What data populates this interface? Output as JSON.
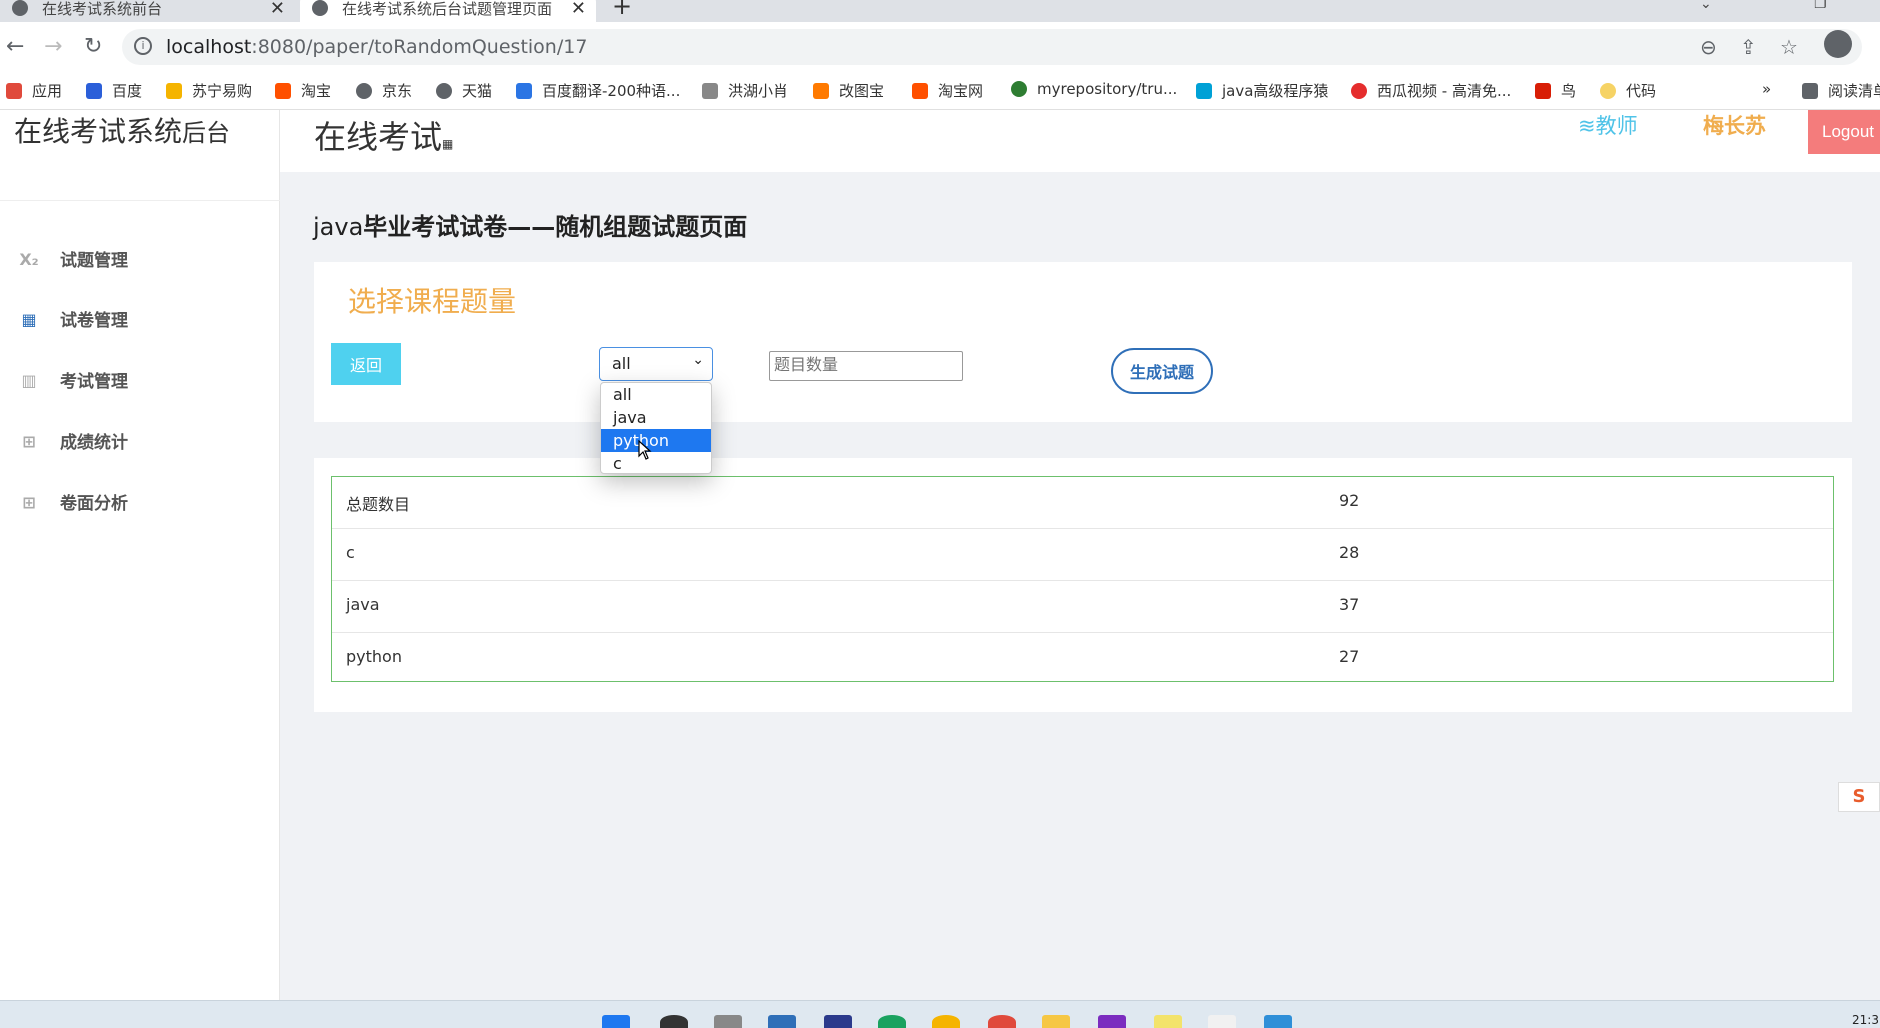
{
  "browser": {
    "tabs": [
      {
        "title": "在线考试系统前台",
        "active": false
      },
      {
        "title": "在线考试系统后台试题管理页面",
        "active": true
      }
    ],
    "url_host": "localhost",
    "url_path": ":8080/paper/toRandomQuestion/17",
    "bookmarks": [
      {
        "label": "应用",
        "color": "#e04a3c"
      },
      {
        "label": "百度",
        "color": "#2b5fd9"
      },
      {
        "label": "苏宁易购",
        "color": "#f5b400"
      },
      {
        "label": "淘宝",
        "color": "#ff5000"
      },
      {
        "label": "京东",
        "color": "#5f6368"
      },
      {
        "label": "天猫",
        "color": "#5f6368"
      },
      {
        "label": "百度翻译-200种语...",
        "color": "#2b75e4"
      },
      {
        "label": "洪湖小肖",
        "color": "#888888"
      },
      {
        "label": "改图宝",
        "color": "#ff7a00"
      },
      {
        "label": "淘宝网",
        "color": "#ff5000"
      },
      {
        "label": "myrepository/tru...",
        "color": "#2e7d32"
      },
      {
        "label": "java高级程序猿",
        "color": "#00a1d6"
      },
      {
        "label": "西瓜视频 - 高清免...",
        "color": "#e52d2d"
      },
      {
        "label": "鸟",
        "color": "#d81e06"
      },
      {
        "label": "代码",
        "color": "#f6d365"
      }
    ],
    "bookmarks_more": "»",
    "reading_list": "阅读清单"
  },
  "sidebar": {
    "brand_main": "在线考试系统",
    "brand_sub": "后台",
    "items": [
      {
        "label": "试题管理",
        "icon": "subscript-icon"
      },
      {
        "label": "试卷管理",
        "icon": "grid-icon"
      },
      {
        "label": "考试管理",
        "icon": "map-icon"
      },
      {
        "label": "成绩统计",
        "icon": "sitemap-icon"
      },
      {
        "label": "卷面分析",
        "icon": "sitemap-icon"
      }
    ]
  },
  "header": {
    "title": "在线考试",
    "title_mark": "▦",
    "role": "教师",
    "username": "梅长苏",
    "logout": "Logout"
  },
  "page": {
    "heading_prefix": "java",
    "heading_main": "毕业考试试卷——随机组题试题页面"
  },
  "form": {
    "section_title": "选择课程题量",
    "back_label": "返回",
    "select_value": "all",
    "options": [
      "all",
      "java",
      "python",
      "c"
    ],
    "highlighted_option": "python",
    "count_placeholder": "题目数量",
    "generate_label": "生成试题"
  },
  "stats": {
    "rows": [
      {
        "name": "总题数目",
        "count": "92"
      },
      {
        "name": "c",
        "count": "28"
      },
      {
        "name": "java",
        "count": "37"
      },
      {
        "name": "python",
        "count": "27"
      }
    ]
  },
  "ime_label": "S",
  "clock": "21:3"
}
